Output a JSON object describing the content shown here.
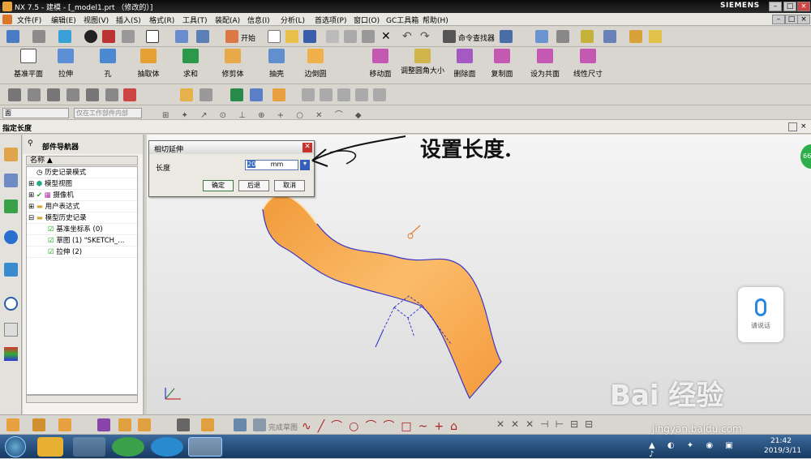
{
  "window": {
    "title": "NX 7.5 - 建模 - [_model1.prt （修改的）]",
    "brand": "SIEMENS"
  },
  "menu": [
    "文件(F)",
    "编辑(E)",
    "视图(V)",
    "插入(S)",
    "格式(R)",
    "工具(T)",
    "装配(A)",
    "信息(I)",
    "分析(L)",
    "首选项(P)",
    "窗口(O)",
    "GC工具箱",
    "帮助(H)"
  ],
  "toolbar1": {
    "start_label": "开始",
    "command_finder": "命令查找器"
  },
  "features": [
    "基准平面",
    "拉伸",
    "孔",
    "抽取体",
    "求和",
    "修剪体",
    "抽壳",
    "边倒圆"
  ],
  "sync_modeling": [
    "移动面",
    "调整圆角大小",
    "删除面",
    "复制面",
    "设为共面",
    "线性尺寸"
  ],
  "filter": {
    "type": "面",
    "scope": "仅在工作部件内部"
  },
  "command_prompt": "指定长度",
  "navigator": {
    "title": "部件导航器",
    "column": "名称",
    "items": [
      "历史记录模式",
      "模型视图",
      "摄像机",
      "用户表达式",
      "模型历史记录",
      "基准坐标系 (0)",
      "草图 (1) \"SKETCH_...",
      "拉伸 (2)"
    ]
  },
  "dialog": {
    "title": "相切延伸",
    "length_label": "长度",
    "length_value": "20",
    "unit": "mm",
    "ok": "确定",
    "back": "后退",
    "cancel": "取消"
  },
  "annotation": "设置长度.",
  "voice": {
    "label": "请说话"
  },
  "badge": "66",
  "sketch_toolbar": {
    "finish": "完成草图"
  },
  "tray": {
    "time": "21:42",
    "date": "2019/3/11"
  },
  "watermark": {
    "brand": "Bai 经验",
    "url": "jingyan.baidu.com"
  },
  "colors": {
    "surface": "#f7a04a",
    "titlebar": "#141414",
    "taskbar": "#245184"
  }
}
